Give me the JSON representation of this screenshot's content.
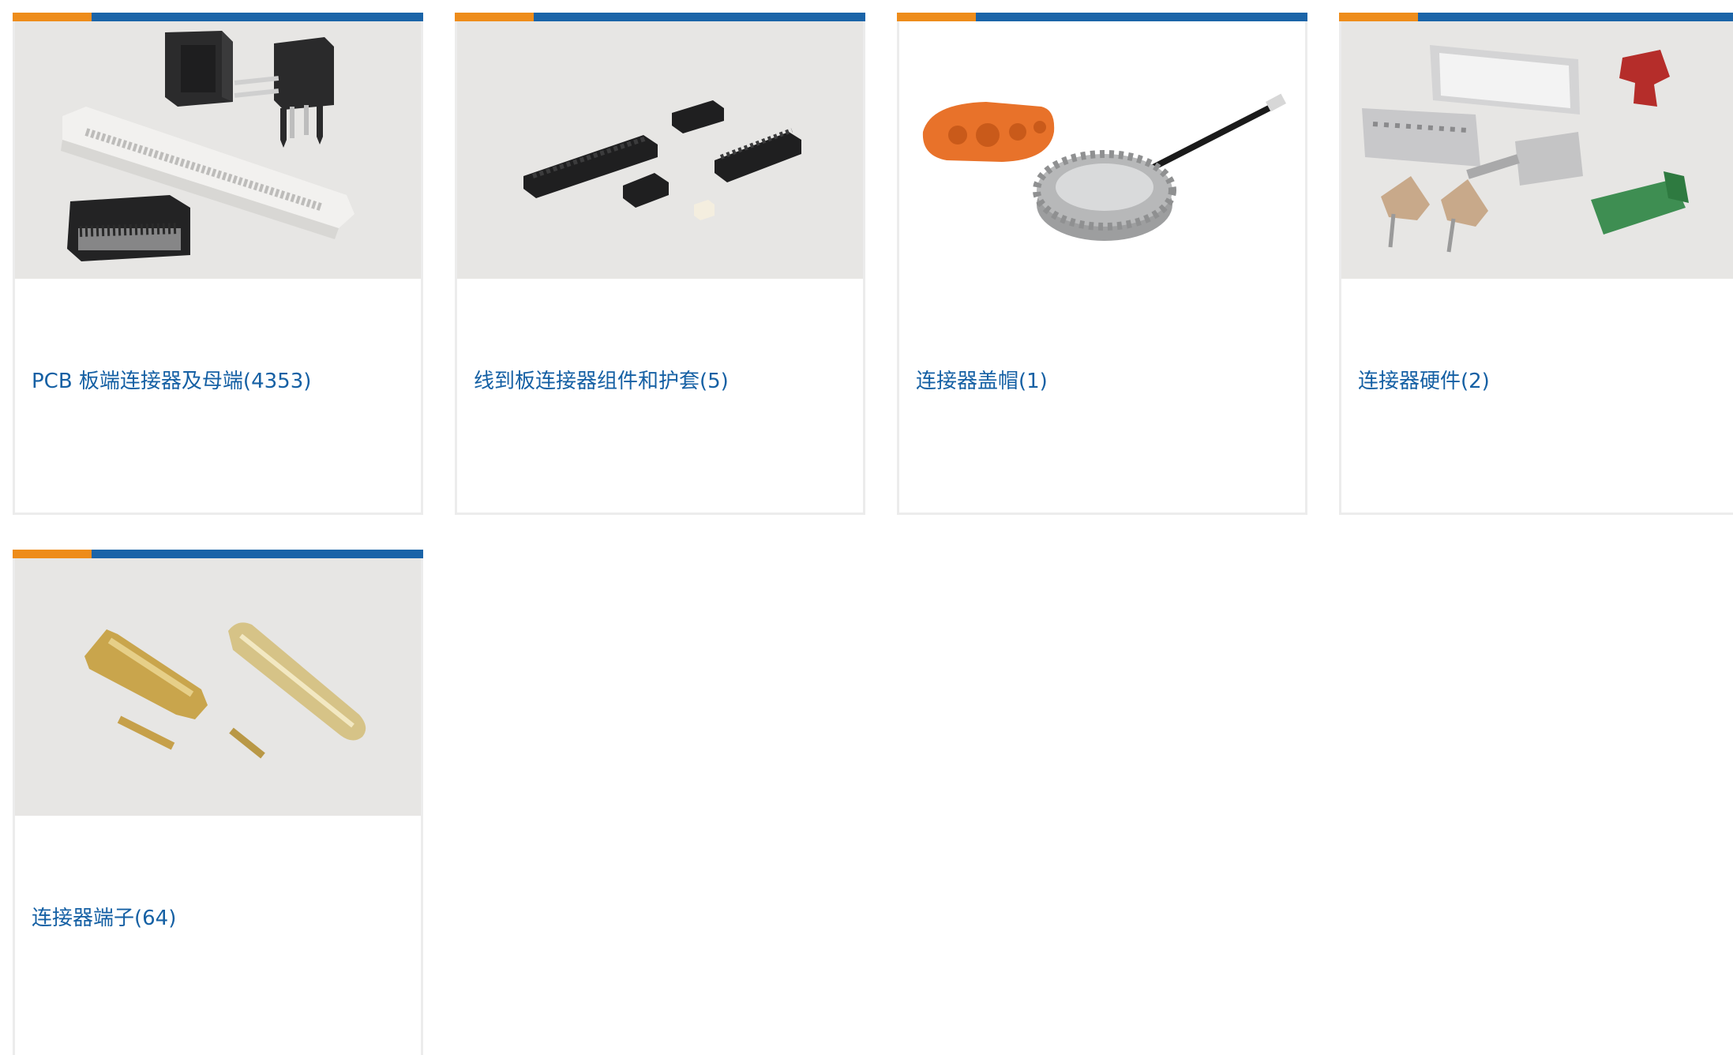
{
  "categories": [
    {
      "label": "PCB 板端连接器及母端(4353)",
      "image": "pcb-connectors-image"
    },
    {
      "label": "线到板连接器组件和护套(5)",
      "image": "wire-to-board-image"
    },
    {
      "label": "连接器盖帽(1)",
      "image": "connector-cap-image"
    },
    {
      "label": "连接器硬件(2)",
      "image": "connector-hardware-image"
    },
    {
      "label": "连接器端子(64)",
      "image": "connector-terminals-image"
    }
  ],
  "colors": {
    "accent_orange": "#ee8c1a",
    "accent_blue": "#1a64a8",
    "link_text": "#1560a4",
    "image_background": "#e7e6e4",
    "card_border": "#ececec"
  }
}
